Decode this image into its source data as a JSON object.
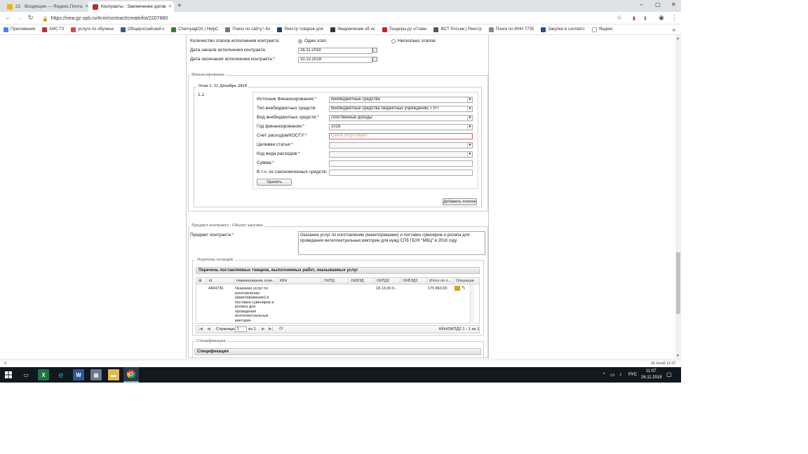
{
  "browser": {
    "tabs": [
      {
        "label": "22 · Входящие — Яндекс.Почта",
        "close": "×"
      },
      {
        "label": "Контракты : Заключение догов",
        "close": "×"
      }
    ],
    "new_tab": "+",
    "window_controls": {
      "minimize": "–",
      "maximize": "▢",
      "close": "✕"
    },
    "url": "https://new.gz-spb.ru/#cm/contract/create/lot/2207860",
    "bookmarks": [
      "Приложения",
      "АИС ГЗ",
      "услуги по обучени",
      "Общероссийский к",
      "ChernyagiOA | HelpC",
      "Поиск по сайту \\ Ко",
      "Реестр товаров для",
      "Уведомление об ис",
      "Тендеры.ру «Главн",
      "ФСТ России | Реестр",
      "Поиск по ИНН 7735",
      "Закупки в соответс",
      "Яндекс"
    ],
    "bookmarks_more": "»"
  },
  "contract": {
    "stages_count_label": "Количество этапов исполнения контракта:",
    "stage_option_one": "Один этап",
    "stage_option_many": "Несколько этапов",
    "start_date_label": "Дата начала исполнения контракта:",
    "start_date": "26.11.2018",
    "end_date_label": "Дата окончания исполнения контракта:",
    "end_date": "31.12.2018",
    "required_mark": "*"
  },
  "financing": {
    "legend": "Финансирование",
    "stage_legend": "Этап 1. 31 Декабрь 2018",
    "item_number": "1.1:",
    "source_label": "Источник Финансирования:",
    "source_value": "Внебюджетные средства",
    "type_label": "Тип внебюджетных средств:",
    "type_value": "Внебюджетные средства бюджетных учреждений, ГУП",
    "kind_label": "Вид внебюджетных средств:",
    "kind_value": "собственные доходы",
    "year_label": "Год финансирования:",
    "year_value": "2018",
    "account_label": "Счет расходов/КОСГУ:",
    "account_placeholder": "Счета отсутствуют",
    "article_label": "Целевая статья:",
    "expense_code_label": "Код вида расходов:",
    "sum_label": "Сумма:",
    "savings_label": "В т.ч. из сэкономленных средств:",
    "delete_button": "Удалить",
    "add_payment_button": "Добавить платеж"
  },
  "subject": {
    "legend": "Предмет контракта / Объект закупки",
    "label": "Предмет контракта:",
    "text": "Оказание услуг по изготовлению (макетированию) и поставке сувениров и ролапа для проведения интеллектуальных викторин для нужд СПб ГБУК \"МВЦ\" в 2018 году"
  },
  "positions": {
    "legend": "Перечень позиций",
    "grid_title": "Перечень поставляемых товаров, выполняемых работ, оказываемых услуг",
    "columns": [
      "id",
      "Наименование пози...",
      "ККН",
      "ОКПД",
      "ОКВЭД",
      "ОКПД2",
      "ОКВЭД2",
      "Итого по п...",
      "Операции"
    ],
    "row": {
      "id": "4404736",
      "name": "Оказание услуг по изготовлению (макетированию) и поставке сувениров и ролапа для проведения интеллектуальных викторин",
      "okpd2": "18.13.30.0...",
      "total": "179 843.00"
    },
    "pager": {
      "page_label": "Страница",
      "page": "1",
      "of": "из 1",
      "summary": "ККН/ОКПД2 1 - 1 из 1"
    }
  },
  "specification": {
    "legend": "Спецификация",
    "grid_title": "Спецификация"
  },
  "status": {
    "left": "0",
    "right": "26 Ноя6 11:07"
  },
  "taskbar": {
    "lang": "РУС",
    "time": "11:07",
    "date": "26.11.2018"
  }
}
